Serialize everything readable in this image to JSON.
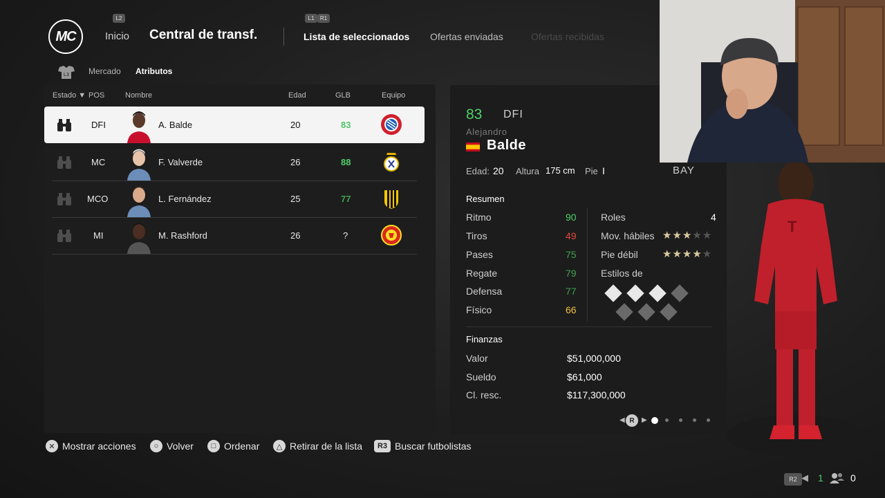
{
  "header": {
    "logo_text": "MC",
    "hint_l2": "L2",
    "hint_l1": "L1",
    "hint_r1": "R1",
    "nav_inicio": "Inicio",
    "nav_title": "Central de transf.",
    "tabs": [
      {
        "label": "Lista de seleccionados",
        "state": "active"
      },
      {
        "label": "Ofertas enviadas",
        "state": "normal"
      },
      {
        "label": "Ofertas recibidas",
        "state": "disabled"
      }
    ]
  },
  "subnav": {
    "hint": "L3",
    "mercado": "Mercado",
    "atributos": "Atributos"
  },
  "table": {
    "headers": {
      "estado": "Estado ▼",
      "pos": "POS",
      "nombre": "Nombre",
      "edad": "Edad",
      "glb": "GLB",
      "equipo": "Equipo"
    },
    "rows": [
      {
        "pos": "DFI",
        "name": "A. Balde",
        "age": "20",
        "glb": "83",
        "glb_color": "#4fc56a",
        "team_icon": "bayern-crest-icon",
        "selected": true
      },
      {
        "pos": "MC",
        "name": "F. Valverde",
        "age": "26",
        "glb": "88",
        "glb_color": "#4fd06a",
        "team_icon": "real-madrid-crest-icon",
        "selected": false
      },
      {
        "pos": "MCO",
        "name": "L. Fernández",
        "age": "25",
        "glb": "77",
        "glb_color": "#3fa34f",
        "team_icon": "penarol-crest-icon",
        "selected": false
      },
      {
        "pos": "MI",
        "name": "M. Rashford",
        "age": "26",
        "glb": "?",
        "glb_color": "#e8e8e8",
        "team_icon": "man-united-crest-icon",
        "selected": false
      }
    ]
  },
  "player": {
    "overall": "83",
    "position": "DFI",
    "first_name": "Alejandro",
    "last_name": "Balde",
    "flag": "spain-flag-icon",
    "age_label": "Edad:",
    "age": "20",
    "height_label": "Altura",
    "height": "175 cm",
    "foot_label": "Pie",
    "foot": "I",
    "team_abbr": "BAY"
  },
  "summary": {
    "title": "Resumen",
    "stats": [
      {
        "label": "Ritmo",
        "value": "90",
        "color": "#4fd06a"
      },
      {
        "label": "Tiros",
        "value": "49",
        "color": "#e5483f"
      },
      {
        "label": "Pases",
        "value": "75",
        "color": "#3fa34f"
      },
      {
        "label": "Regate",
        "value": "79",
        "color": "#3fa34f"
      },
      {
        "label": "Defensa",
        "value": "77",
        "color": "#3fa34f"
      },
      {
        "label": "Físico",
        "value": "66",
        "color": "#f0c040"
      }
    ],
    "roles_label": "Roles",
    "roles_value": "4",
    "skill_moves_label": "Mov. hábiles",
    "skill_moves": 3,
    "weak_foot_label": "Pie débil",
    "weak_foot": 4,
    "styles_label": "Estilos de"
  },
  "finance": {
    "title": "Finanzas",
    "rows": [
      {
        "label": "Valor",
        "value": "$51,000,000"
      },
      {
        "label": "Sueldo",
        "value": "$61,000"
      },
      {
        "label": "Cl. resc.",
        "value": "$117,300,000"
      }
    ]
  },
  "pager": {
    "hint": "R",
    "pages": 5,
    "current": 1
  },
  "actions": [
    {
      "icon": "cross-button-icon",
      "glyph": "✕",
      "label": "Mostrar acciones"
    },
    {
      "icon": "circle-button-icon",
      "glyph": "○",
      "label": "Volver"
    },
    {
      "icon": "square-button-icon",
      "glyph": "□",
      "label": "Ordenar"
    },
    {
      "icon": "triangle-button-icon",
      "glyph": "△",
      "label": "Retirar de la lista"
    },
    {
      "icon": "r3-button-icon",
      "glyph": "R3",
      "label": "Buscar futbolistas"
    }
  ],
  "status": {
    "r2_hint": "R2",
    "voice_count": "1",
    "party_count": "0"
  },
  "colors": {
    "accent_green": "#4fd06a",
    "panel": "#1c1c1c",
    "selected_row": "#f4f4f4",
    "bayern_red": "#d0202e"
  }
}
